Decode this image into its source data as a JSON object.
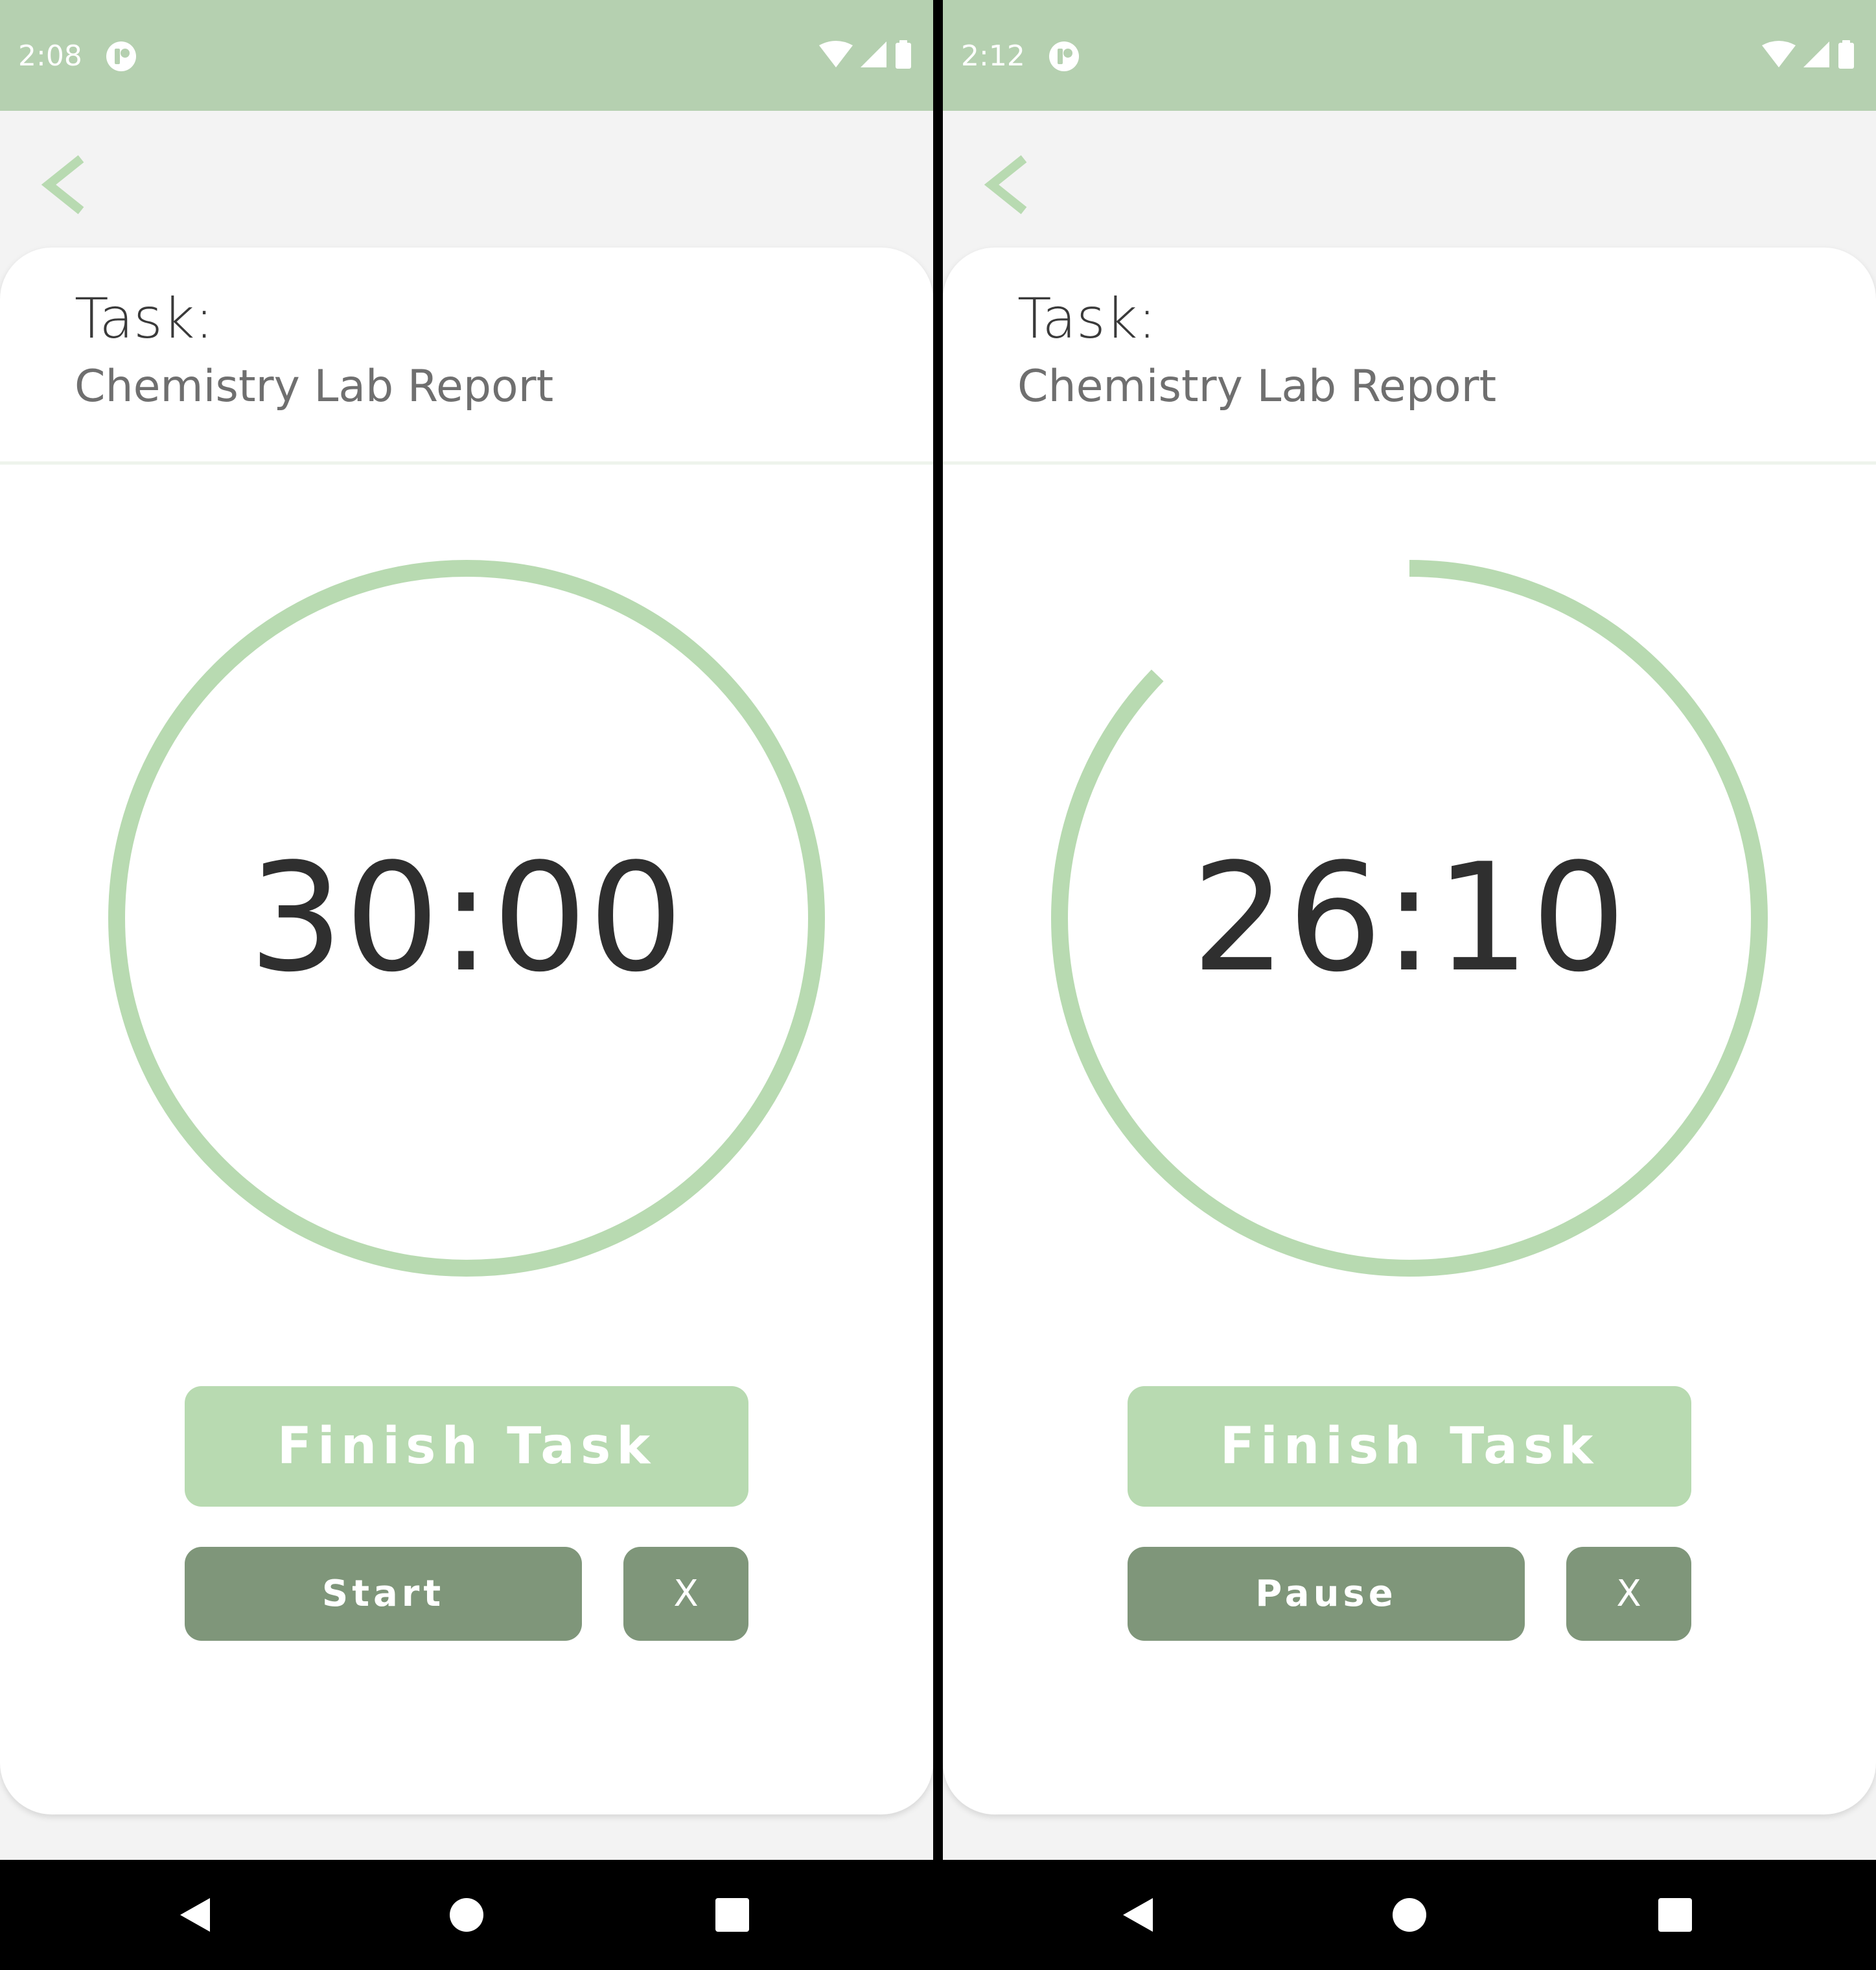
{
  "colors": {
    "status_bar": "#b5d0b0",
    "accent": "#b8dab1",
    "button_dark": "#7f967a",
    "background": "#f3f3f3"
  },
  "screens": [
    {
      "status": {
        "time": "2:08"
      },
      "task": {
        "label": "Task:",
        "name": "Chemistry Lab Report"
      },
      "timer": {
        "display": "30:00",
        "remaining_fraction": 1.0
      },
      "buttons": {
        "finish": "Finish Task",
        "toggle": "Start",
        "cancel": "X"
      }
    },
    {
      "status": {
        "time": "2:12"
      },
      "task": {
        "label": "Task:",
        "name": "Chemistry Lab Report"
      },
      "timer": {
        "display": "26:10",
        "remaining_fraction": 0.872
      },
      "buttons": {
        "finish": "Finish Task",
        "toggle": "Pause",
        "cancel": "X"
      }
    }
  ],
  "icons": {
    "status_left": "app-notification-icon",
    "status_right": [
      "wifi-icon",
      "cell-signal-icon",
      "battery-icon"
    ],
    "back": "chevron-left-icon",
    "nav": [
      "nav-back-icon",
      "nav-home-icon",
      "nav-recents-icon"
    ]
  }
}
